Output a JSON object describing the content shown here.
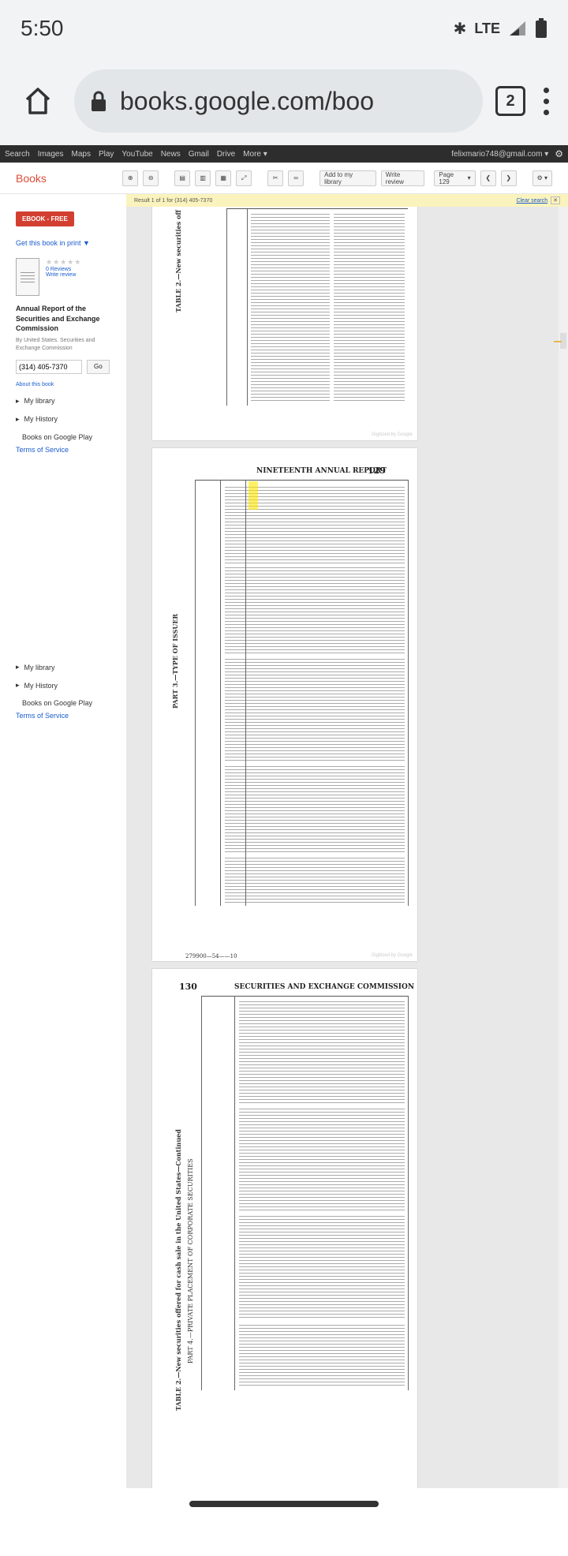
{
  "status": {
    "time": "5:50",
    "network": "LTE"
  },
  "browser": {
    "url": "books.google.com/boo",
    "tab_count": "2"
  },
  "gbar": {
    "links": [
      "Search",
      "Images",
      "Maps",
      "Play",
      "YouTube",
      "News",
      "Gmail",
      "Drive",
      "More ▾"
    ],
    "account": "felixmario748@gmail.com ▾"
  },
  "toolbar": {
    "brand": "Books",
    "add_library": "Add to my library",
    "write_review": "Write review",
    "page_select": "Page 129"
  },
  "banner": {
    "text": "Result 1 of 1 for (314) 405-7370",
    "clear": "Clear search"
  },
  "sidebar": {
    "ebook": "EBOOK - FREE",
    "get_print": "Get this book in print ▼",
    "reviews": "0 Reviews",
    "write_review": "Write review",
    "title": "Annual Report of the Securities and Exchange Commission",
    "by": "By United States. Securities and Exchange Commission",
    "search_value": "(314) 405-7370",
    "go": "Go",
    "about": "About this book",
    "my_library": "My library",
    "my_history": "My History",
    "play": "Books on Google Play",
    "terms": "Terms of Service"
  },
  "pages": {
    "p1_title": "TABLE 2.—New securities off",
    "p2_header": "NINETEENTH ANNUAL REPORT",
    "p2_num": "129",
    "p2_title": "PART 3.—TYPE OF ISSUER",
    "p2_foot": "279900—54——10",
    "p3_num": "130",
    "p3_header": "SECURITIES AND EXCHANGE COMMISSION",
    "p3_title": "TABLE 2.—New securities offered for cash sale in the United States—Continued",
    "p3_sub": "PART 4.—PRIVATE PLACEMENT OF CORPORATE SECURITIES",
    "digitized": "Digitized by Google"
  }
}
